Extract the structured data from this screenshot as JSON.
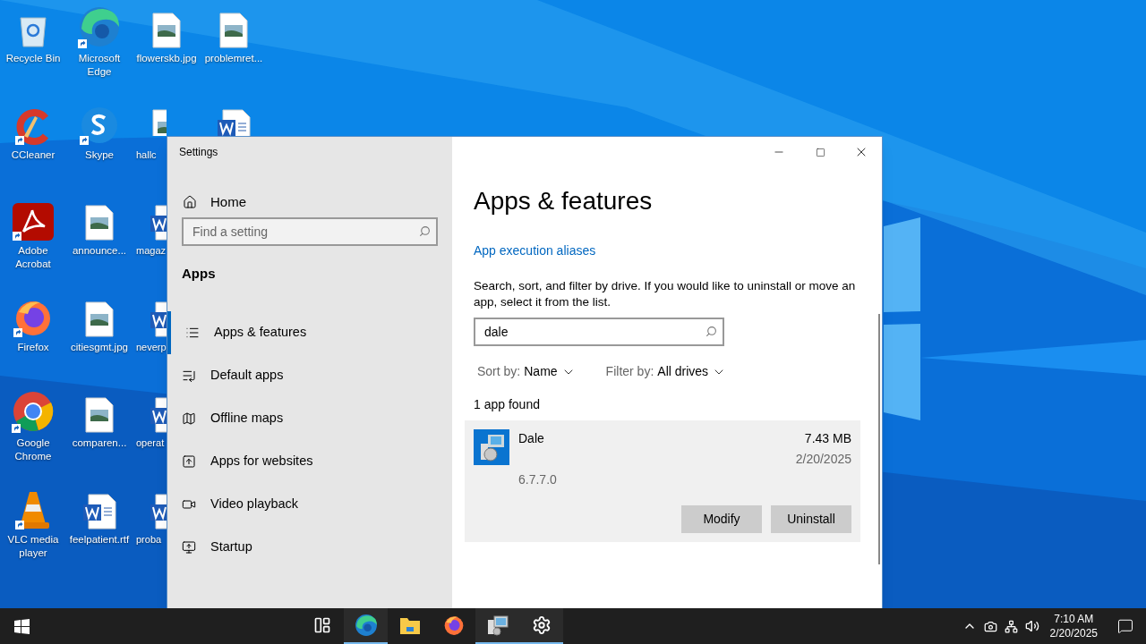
{
  "desktop": {
    "icons": [
      {
        "label": "Recycle Bin",
        "kind": "recycle",
        "shortcut": false
      },
      {
        "label": "CCleaner",
        "kind": "ccleaner",
        "shortcut": true
      },
      {
        "label": "Adobe Acrobat",
        "kind": "acrobat",
        "shortcut": true
      },
      {
        "label": "Firefox",
        "kind": "firefox",
        "shortcut": true
      },
      {
        "label": "Google Chrome",
        "kind": "chrome",
        "shortcut": true
      },
      {
        "label": "VLC media player",
        "kind": "vlc",
        "shortcut": true
      },
      {
        "label": "Microsoft Edge",
        "kind": "edge",
        "shortcut": true
      },
      {
        "label": "Skype",
        "kind": "skype",
        "shortcut": true
      },
      {
        "label": "announce...",
        "shortcut": false
      },
      {
        "label": "citiesgmt.jpg",
        "shortcut": false
      },
      {
        "label": "comparen...",
        "shortcut": false
      },
      {
        "label": "feelpatient.rtf",
        "kind": "word",
        "shortcut": false
      },
      {
        "label": "flowerskb.jpg",
        "shortcut": false
      },
      {
        "label": "hallc"
      },
      {
        "label": "magaz",
        "kind": "word",
        "shortcut": false
      },
      {
        "label": "neverp",
        "kind": "word",
        "shortcut": false
      },
      {
        "label": "operat",
        "kind": "word",
        "shortcut": false
      },
      {
        "label": "proba",
        "kind": "word",
        "shortcut": false
      },
      {
        "label": "problemret...",
        "shortcut": false
      },
      {
        "kind": "word"
      }
    ]
  },
  "window": {
    "title": "Settings",
    "sidebar": {
      "home": "Home",
      "search": {
        "placeholder": "Find a setting"
      },
      "section": "Apps",
      "items": [
        {
          "label": "Apps & features",
          "selected": true
        },
        {
          "label": "Default apps",
          "selected": false
        },
        {
          "label": "Offline maps",
          "selected": false
        },
        {
          "label": "Apps for websites",
          "selected": false
        },
        {
          "label": "Video playback",
          "selected": false
        },
        {
          "label": "Startup",
          "selected": false
        }
      ]
    },
    "content": {
      "heading": "Apps & features",
      "link": "App execution aliases",
      "description": "Search, sort, and filter by drive. If you would like to uninstall or move an app, select it from the list.",
      "search": {
        "value": "dale"
      },
      "sort": {
        "label": "Sort by:",
        "value": "Name"
      },
      "filter": {
        "label": "Filter by:",
        "value": "All drives"
      },
      "count": "1 app found",
      "apps": [
        {
          "name": "Dale",
          "size": "7.43 MB",
          "date": "2/20/2025",
          "version": "6.7.7.0",
          "selected": true,
          "buttons": [
            "Modify",
            "Uninstall"
          ]
        }
      ]
    }
  },
  "taskbar": {
    "apps": [
      {
        "kind": "task-view",
        "running": false
      },
      {
        "kind": "edge",
        "running": true
      },
      {
        "kind": "explorer",
        "running": false
      },
      {
        "kind": "firefox",
        "running": false
      },
      {
        "kind": "installer",
        "running": true
      },
      {
        "kind": "settings",
        "running": true
      }
    ],
    "time": "7:10 AM",
    "date": "2/20/2025"
  }
}
